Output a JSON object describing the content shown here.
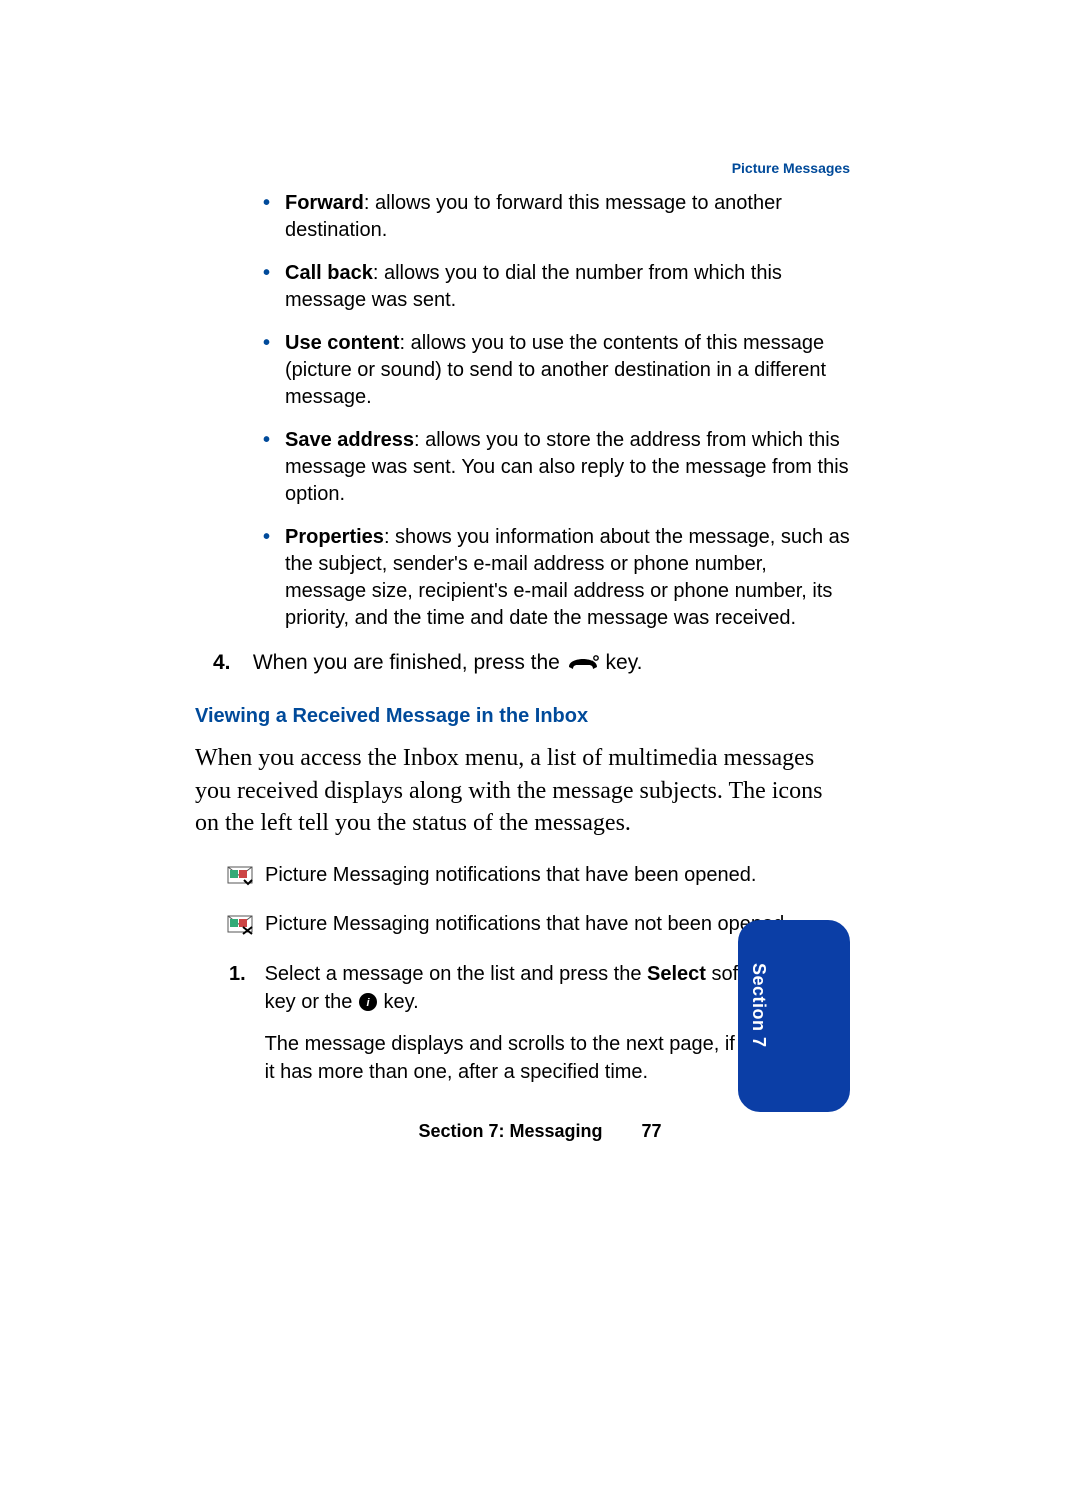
{
  "header": {
    "running": "Picture Messages"
  },
  "bullets": [
    {
      "term": "Forward",
      "desc": ": allows you to forward this message to another destination."
    },
    {
      "term": "Call back",
      "desc": ": allows you to dial the number from which this message was sent."
    },
    {
      "term": "Use content",
      "desc": ": allows you to use the contents of this message (picture or sound) to send to another destination in a different message."
    },
    {
      "term": "Save address",
      "desc": ": allows you to store the address from which this message was sent. You can also reply to the message from this option."
    },
    {
      "term": "Properties",
      "desc": ": shows you information about the message, such as the subject, sender's e-mail address or phone number, message size, recipient's e-mail address or phone number, its priority, and the time and date the message was received."
    }
  ],
  "step4": {
    "num": "4.",
    "pre": "When you are finished, press the ",
    "post": " key."
  },
  "subhead": "Viewing a Received Message in the Inbox",
  "para": "When you access the Inbox menu, a list of multimedia messages you received displays along with the message subjects. The icons on the left tell you the status of the messages.",
  "iconlines": [
    "Picture Messaging notifications that have been opened.",
    "Picture Messaging notifications that have not been opened."
  ],
  "ol1": {
    "num": "1.",
    "p1a": "Select a message on the list and press the ",
    "p1b": "Select",
    "p1c": " soft key or the ",
    "p1d": " key.",
    "p2": "The message displays and scrolls to the next page, if it has more than one, after a specified time."
  },
  "footer": {
    "label": "Section 7: Messaging",
    "page": "77"
  },
  "tab": {
    "text": "Section 7"
  }
}
